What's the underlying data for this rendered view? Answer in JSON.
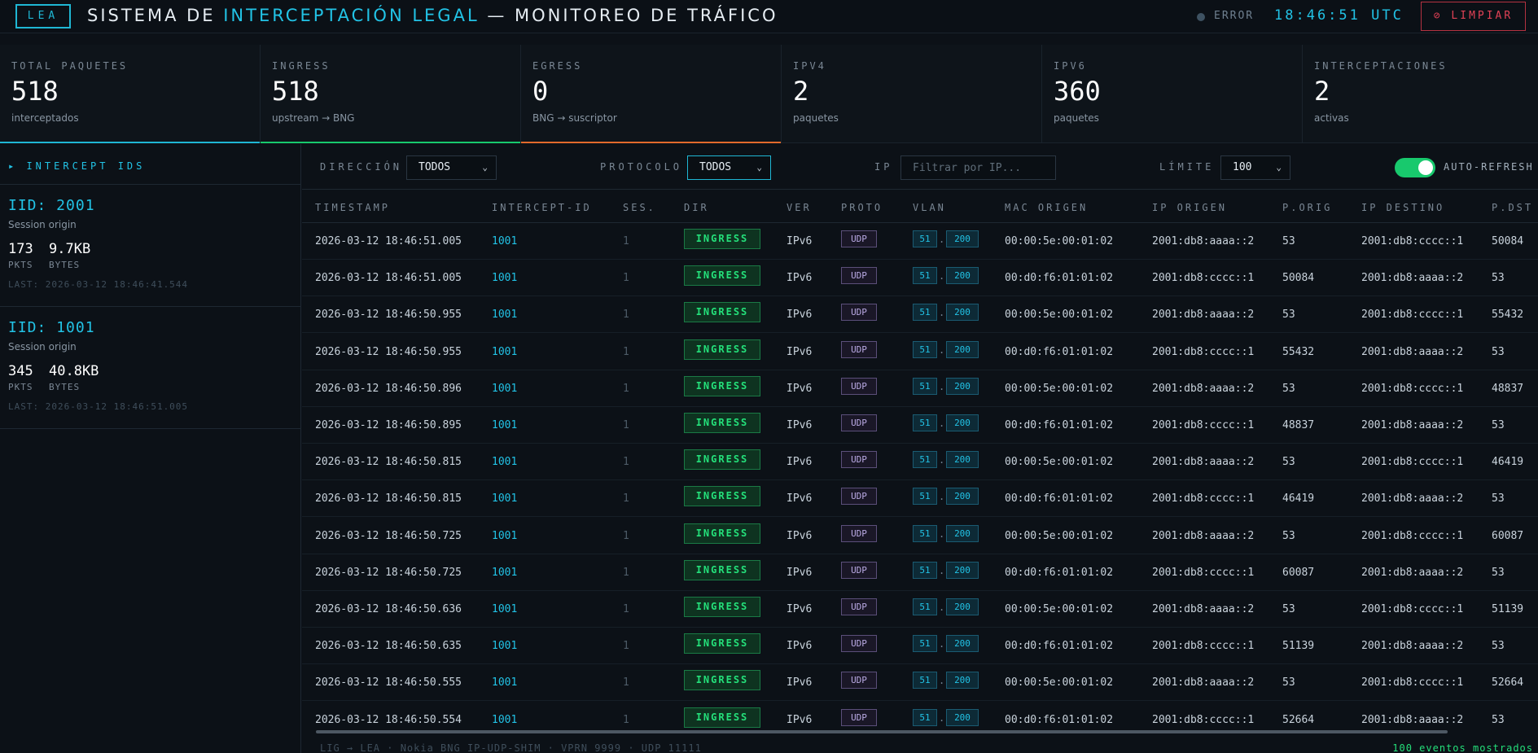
{
  "header": {
    "logo": "LEA",
    "title_a": "SISTEMA DE ",
    "title_hl": "INTERCEPTACIÓN LEGAL",
    "title_b": " — MONITOREO DE TRÁFICO",
    "status": "ERROR",
    "clock": "18:46:51 UTC",
    "clear_label": "⊘ LIMPIAR"
  },
  "stats": [
    {
      "label": "TOTAL PAQUETES",
      "value": "518",
      "sub": "interceptados",
      "accent": "#1fb7d4"
    },
    {
      "label": "INGRESS",
      "value": "518",
      "sub": "upstream → BNG",
      "accent": "#18c96d"
    },
    {
      "label": "EGRESS",
      "value": "0",
      "sub": "BNG → suscriptor",
      "accent": "#e26a2c"
    },
    {
      "label": "IPV4",
      "value": "2",
      "sub": "paquetes",
      "accent": ""
    },
    {
      "label": "IPV6",
      "value": "360",
      "sub": "paquetes",
      "accent": ""
    },
    {
      "label": "INTERCEPTACIONES",
      "value": "2",
      "sub": "activas",
      "accent": ""
    }
  ],
  "sidebar": {
    "heading": "▸ INTERCEPT IDS",
    "cards": [
      {
        "iid": "IID: 2001",
        "origin": "Session origin",
        "pkts": "173",
        "bytes": "9.7KB",
        "pkts_label": "PKTS",
        "bytes_label": "BYTES",
        "last": "LAST: 2026-03-12 18:46:41.544"
      },
      {
        "iid": "IID: 1001",
        "origin": "Session origin",
        "pkts": "345",
        "bytes": "40.8KB",
        "pkts_label": "PKTS",
        "bytes_label": "BYTES",
        "last": "LAST: 2026-03-12 18:46:51.005"
      }
    ]
  },
  "filters": {
    "direccion_label": "DIRECCIÓN",
    "direccion_value": "TODOS",
    "protocolo_label": "PROTOCOLO",
    "protocolo_value": "TODOS",
    "ip_label": "IP",
    "ip_placeholder": "Filtrar por IP...",
    "limite_label": "LÍMITE",
    "limite_value": "100",
    "autorefresh_label": "AUTO-REFRESH",
    "autorefresh_on": true
  },
  "table": {
    "columns": [
      "TIMESTAMP",
      "INTERCEPT-ID",
      "SES.",
      "DIR",
      "VER",
      "PROTO",
      "VLAN",
      "MAC ORIGEN",
      "IP ORIGEN",
      "P.ORIG",
      "IP DESTINO",
      "P.DST"
    ],
    "rows": [
      {
        "ts": "2026-03-12 18:46:51.005",
        "iid": "1001",
        "ses": "1",
        "dir": "INGRESS",
        "ver": "IPv6",
        "proto": "UDP",
        "vlan_a": "51",
        "vlan_b": "200",
        "mac": "00:00:5e:00:01:02",
        "ip_src": "2001:db8:aaaa::2",
        "p_src": "53",
        "ip_dst": "2001:db8:cccc::1",
        "p_dst": "50084"
      },
      {
        "ts": "2026-03-12 18:46:51.005",
        "iid": "1001",
        "ses": "1",
        "dir": "INGRESS",
        "ver": "IPv6",
        "proto": "UDP",
        "vlan_a": "51",
        "vlan_b": "200",
        "mac": "00:d0:f6:01:01:02",
        "ip_src": "2001:db8:cccc::1",
        "p_src": "50084",
        "ip_dst": "2001:db8:aaaa::2",
        "p_dst": "53"
      },
      {
        "ts": "2026-03-12 18:46:50.955",
        "iid": "1001",
        "ses": "1",
        "dir": "INGRESS",
        "ver": "IPv6",
        "proto": "UDP",
        "vlan_a": "51",
        "vlan_b": "200",
        "mac": "00:00:5e:00:01:02",
        "ip_src": "2001:db8:aaaa::2",
        "p_src": "53",
        "ip_dst": "2001:db8:cccc::1",
        "p_dst": "55432"
      },
      {
        "ts": "2026-03-12 18:46:50.955",
        "iid": "1001",
        "ses": "1",
        "dir": "INGRESS",
        "ver": "IPv6",
        "proto": "UDP",
        "vlan_a": "51",
        "vlan_b": "200",
        "mac": "00:d0:f6:01:01:02",
        "ip_src": "2001:db8:cccc::1",
        "p_src": "55432",
        "ip_dst": "2001:db8:aaaa::2",
        "p_dst": "53"
      },
      {
        "ts": "2026-03-12 18:46:50.896",
        "iid": "1001",
        "ses": "1",
        "dir": "INGRESS",
        "ver": "IPv6",
        "proto": "UDP",
        "vlan_a": "51",
        "vlan_b": "200",
        "mac": "00:00:5e:00:01:02",
        "ip_src": "2001:db8:aaaa::2",
        "p_src": "53",
        "ip_dst": "2001:db8:cccc::1",
        "p_dst": "48837"
      },
      {
        "ts": "2026-03-12 18:46:50.895",
        "iid": "1001",
        "ses": "1",
        "dir": "INGRESS",
        "ver": "IPv6",
        "proto": "UDP",
        "vlan_a": "51",
        "vlan_b": "200",
        "mac": "00:d0:f6:01:01:02",
        "ip_src": "2001:db8:cccc::1",
        "p_src": "48837",
        "ip_dst": "2001:db8:aaaa::2",
        "p_dst": "53"
      },
      {
        "ts": "2026-03-12 18:46:50.815",
        "iid": "1001",
        "ses": "1",
        "dir": "INGRESS",
        "ver": "IPv6",
        "proto": "UDP",
        "vlan_a": "51",
        "vlan_b": "200",
        "mac": "00:00:5e:00:01:02",
        "ip_src": "2001:db8:aaaa::2",
        "p_src": "53",
        "ip_dst": "2001:db8:cccc::1",
        "p_dst": "46419"
      },
      {
        "ts": "2026-03-12 18:46:50.815",
        "iid": "1001",
        "ses": "1",
        "dir": "INGRESS",
        "ver": "IPv6",
        "proto": "UDP",
        "vlan_a": "51",
        "vlan_b": "200",
        "mac": "00:d0:f6:01:01:02",
        "ip_src": "2001:db8:cccc::1",
        "p_src": "46419",
        "ip_dst": "2001:db8:aaaa::2",
        "p_dst": "53"
      },
      {
        "ts": "2026-03-12 18:46:50.725",
        "iid": "1001",
        "ses": "1",
        "dir": "INGRESS",
        "ver": "IPv6",
        "proto": "UDP",
        "vlan_a": "51",
        "vlan_b": "200",
        "mac": "00:00:5e:00:01:02",
        "ip_src": "2001:db8:aaaa::2",
        "p_src": "53",
        "ip_dst": "2001:db8:cccc::1",
        "p_dst": "60087"
      },
      {
        "ts": "2026-03-12 18:46:50.725",
        "iid": "1001",
        "ses": "1",
        "dir": "INGRESS",
        "ver": "IPv6",
        "proto": "UDP",
        "vlan_a": "51",
        "vlan_b": "200",
        "mac": "00:d0:f6:01:01:02",
        "ip_src": "2001:db8:cccc::1",
        "p_src": "60087",
        "ip_dst": "2001:db8:aaaa::2",
        "p_dst": "53"
      },
      {
        "ts": "2026-03-12 18:46:50.636",
        "iid": "1001",
        "ses": "1",
        "dir": "INGRESS",
        "ver": "IPv6",
        "proto": "UDP",
        "vlan_a": "51",
        "vlan_b": "200",
        "mac": "00:00:5e:00:01:02",
        "ip_src": "2001:db8:aaaa::2",
        "p_src": "53",
        "ip_dst": "2001:db8:cccc::1",
        "p_dst": "51139"
      },
      {
        "ts": "2026-03-12 18:46:50.635",
        "iid": "1001",
        "ses": "1",
        "dir": "INGRESS",
        "ver": "IPv6",
        "proto": "UDP",
        "vlan_a": "51",
        "vlan_b": "200",
        "mac": "00:d0:f6:01:01:02",
        "ip_src": "2001:db8:cccc::1",
        "p_src": "51139",
        "ip_dst": "2001:db8:aaaa::2",
        "p_dst": "53"
      },
      {
        "ts": "2026-03-12 18:46:50.555",
        "iid": "1001",
        "ses": "1",
        "dir": "INGRESS",
        "ver": "IPv6",
        "proto": "UDP",
        "vlan_a": "51",
        "vlan_b": "200",
        "mac": "00:00:5e:00:01:02",
        "ip_src": "2001:db8:aaaa::2",
        "p_src": "53",
        "ip_dst": "2001:db8:cccc::1",
        "p_dst": "52664"
      },
      {
        "ts": "2026-03-12 18:46:50.554",
        "iid": "1001",
        "ses": "1",
        "dir": "INGRESS",
        "ver": "IPv6",
        "proto": "UDP",
        "vlan_a": "51",
        "vlan_b": "200",
        "mac": "00:d0:f6:01:01:02",
        "ip_src": "2001:db8:cccc::1",
        "p_src": "52664",
        "ip_dst": "2001:db8:aaaa::2",
        "p_dst": "53"
      }
    ]
  },
  "footer": {
    "left": "LIG → LEA · Nokia BNG IP-UDP-SHIM · VPRN 9999 · UDP 11111",
    "right": "100 eventos mostrados"
  }
}
